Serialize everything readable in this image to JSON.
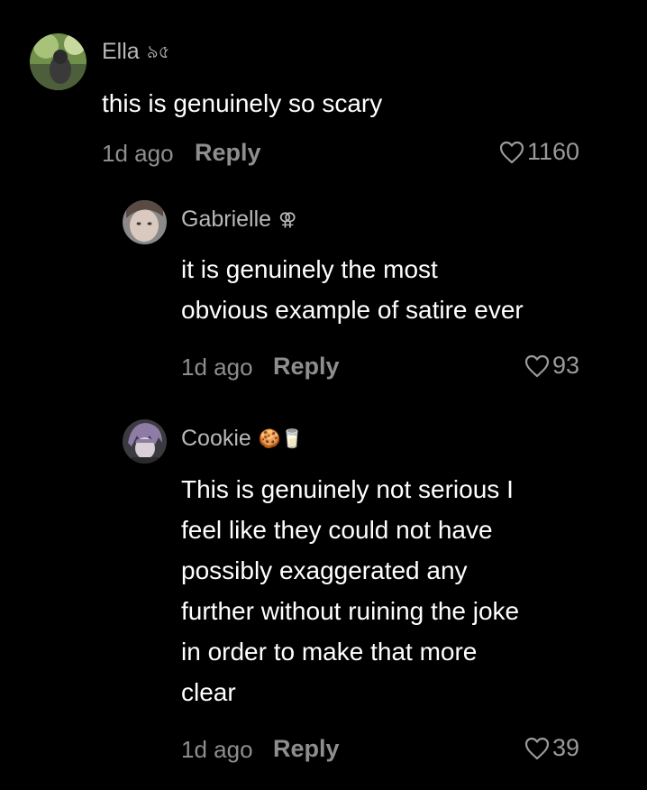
{
  "comments": [
    {
      "username": "Ella",
      "badge": "৯৫",
      "lines": [
        "this is genuinely so scary"
      ],
      "time": "1d ago",
      "reply_label": "Reply",
      "likes": "1160",
      "avatar_icon": "profile-photo-greenery"
    },
    {
      "username": "Gabrielle",
      "badge": "⚢",
      "lines": [
        "it is genuinely the most",
        "obvious example of satire ever"
      ],
      "time": "1d ago",
      "reply_label": "Reply",
      "likes": "93",
      "avatar_icon": "profile-photo-face"
    },
    {
      "username": "Cookie",
      "badge": "🍪🥛",
      "lines": [
        "This is genuinely not serious I",
        "feel like they could not have",
        "possibly exaggerated any",
        "further without ruining the joke",
        "in order to make that more",
        "clear"
      ],
      "time": "1d ago",
      "reply_label": "Reply",
      "likes": "39",
      "avatar_icon": "profile-photo-purple-hair"
    }
  ],
  "colors": {
    "background": "#000000",
    "text": "#ffffff",
    "muted": "#8e8e8e",
    "username": "#b8b8b8"
  }
}
